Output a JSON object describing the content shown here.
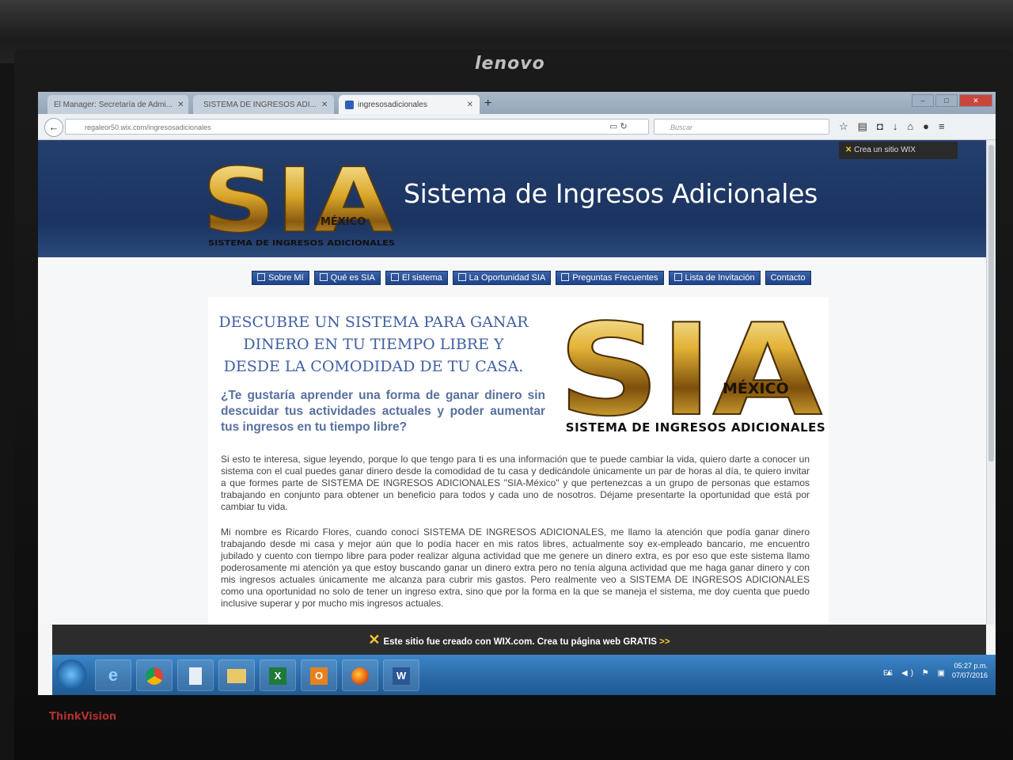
{
  "monitor": {
    "brand": "lenovo",
    "model": "ThinkVision"
  },
  "browser": {
    "tabs": [
      {
        "label": "El Manager: Secretaría de Admi..."
      },
      {
        "label": "SISTEMA DE INGRESOS ADI..."
      },
      {
        "label": "ingresosadicionales"
      }
    ],
    "new_tab": "+",
    "url": "regaleor50.wix.com/ingresosadicionales",
    "search_placeholder": "Buscar"
  },
  "site": {
    "wix_promo": "Crea un sitio WIX",
    "logo_text": "SIA",
    "logo_sub": "MÉXICO",
    "logo_caption_small": "SISTEMA DE INGRESOS ADICIONALES",
    "title": "Sistema de Ingresos Adicionales",
    "menu": [
      "Sobre Mí",
      "Qué es SIA",
      "El sistema",
      "La Oportunidad SIA",
      "Preguntas Frecuentes",
      "Lista de Invitación",
      "Contacto"
    ],
    "headline": "DESCUBRE UN SISTEMA PARA GANAR DINERO EN TU TIEMPO LIBRE Y DESDE LA COMODIDAD DE TU CASA.",
    "question": "¿Te gustaría aprender una forma de ganar dinero sin descuidar tus actividades actuales y poder aumentar tus ingresos en tu tiempo libre?",
    "logo_caption": "SISTEMA DE INGRESOS ADICIONALES",
    "paragraph1": "Si esto te interesa, sigue leyendo, porque lo que tengo para ti es una información que te puede cambiar la vida, quiero darte a conocer un sistema con el cual puedes ganar dinero desde la comodidad de tu casa y dedicándole únicamente un par de horas al día, te quiero invitar a que formes parte de SISTEMA DE INGRESOS ADICIONALES \"SIA-México\" y que pertenezcas a un grupo de personas que estamos trabajando en conjunto para obtener un beneficio para todos y cada uno de nosotros. Déjame presentarte la oportunidad que está por cambiar tu vida.",
    "paragraph2": "Mi nombre es Ricardo Flores, cuando conocí SISTEMA DE INGRESOS ADICIONALES, me llamo la atención que podía ganar dinero trabajando desde mi casa y mejor aún que lo podía hacer en mis ratos libres, actualmente soy ex-empleado bancario, me encuentro jubilado y cuento con tiempo libre para poder realizar alguna actividad que me genere un dinero extra, es por eso que este sistema llamo poderosamente mi atención ya que estoy buscando ganar un dinero extra pero no tenía alguna actividad que me haga ganar dinero y con mis ingresos actuales únicamente me alcanza para cubrir mis gastos. Pero realmente veo a SISTEMA DE INGRESOS ADICIONALES como una oportunidad no solo de tener un ingreso extra, sino que por la forma en la que se maneja el sistema, me doy cuenta que puedo inclusive superar y por mucho mis ingresos actuales.",
    "wix_banner": "Este sitio fue creado con WIX.com. Crea tu página web GRATIS",
    "wix_banner_arrow": ">>"
  },
  "taskbar": {
    "apps": [
      "ie-icon",
      "chrome-icon",
      "notepad-icon",
      "folder-icon",
      "excel-icon",
      "outlook-icon",
      "firefox-icon",
      "word-icon"
    ],
    "excel_letter": "X",
    "outlook_letter": "O",
    "word_letter": "W",
    "language": "ES",
    "time": "05:27 p.m.",
    "date": "07/07/2016"
  },
  "colors": {
    "header_blue": "#1b3360",
    "menu_blue": "#1e4389",
    "headline_blue": "#4060a4",
    "gold": "#d9a72a"
  }
}
